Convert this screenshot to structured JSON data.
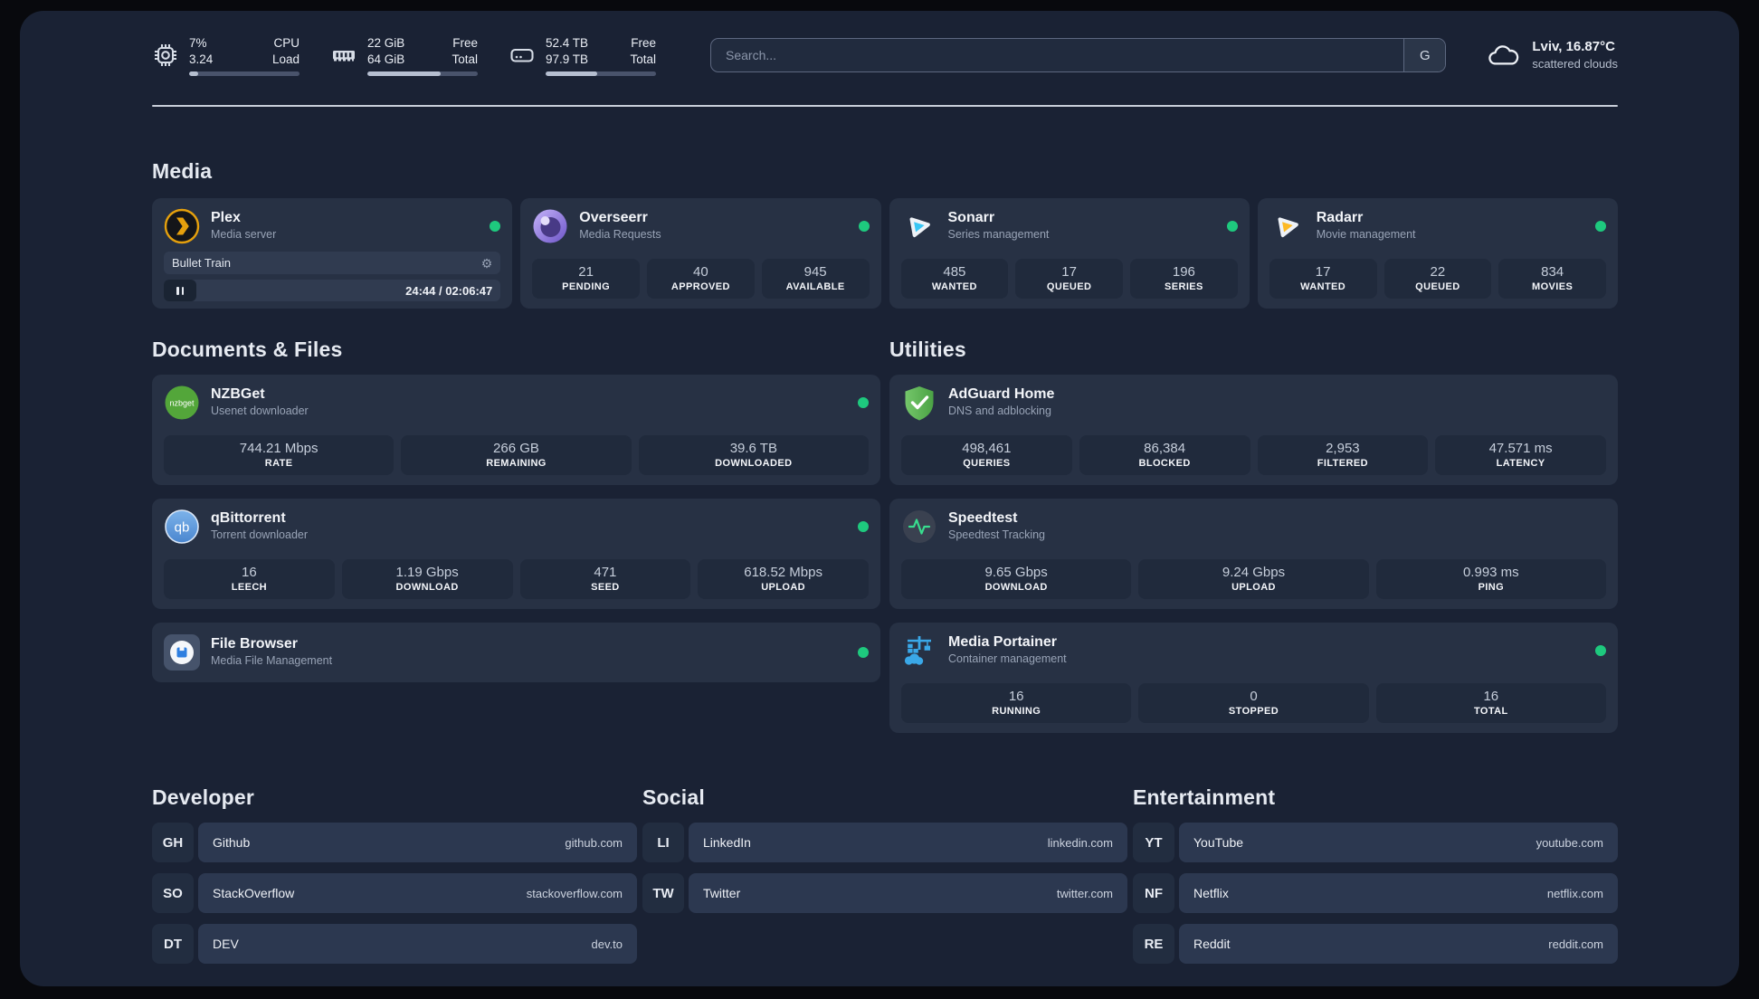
{
  "colors": {
    "status_online": "#1ec97e",
    "plex_accent": "#e5a00d",
    "sonarr_accent": "#38c6f4",
    "radarr_accent": "#fdb924",
    "adguard_green": "#57b14e",
    "portainer_blue": "#3aa8e8",
    "nzbget_green": "#53a63a",
    "speedtest_pulse": "#38dd8e"
  },
  "icons": {
    "gear": "⚙"
  },
  "header": {
    "system_widgets": [
      {
        "icon": "cpu-icon",
        "values": [
          "7%",
          "3.24"
        ],
        "labels": [
          "CPU",
          "Load"
        ],
        "progress_percent": 8
      },
      {
        "icon": "ram-icon",
        "values": [
          "22 GiB",
          "64 GiB"
        ],
        "labels": [
          "Free",
          "Total"
        ],
        "progress_percent": 66
      },
      {
        "icon": "disk-icon",
        "values": [
          "52.4 TB",
          "97.9 TB"
        ],
        "labels": [
          "Free",
          "Total"
        ],
        "progress_percent": 47
      }
    ],
    "search": {
      "placeholder": "Search...",
      "engine_button": "G"
    },
    "weather": {
      "icon": "cloud-icon",
      "title": "Lviv, 16.87°C",
      "subtitle": "scattered clouds"
    }
  },
  "sections": {
    "media": {
      "heading": "Media",
      "cards": {
        "plex": {
          "icon": "plex-icon",
          "title": "Plex",
          "subtitle": "Media server",
          "online": true,
          "player": {
            "now_playing": "Bullet Train",
            "time": "24:44 / 02:06:47"
          }
        },
        "overseerr": {
          "icon": "overseerr-icon",
          "title": "Overseerr",
          "subtitle": "Media Requests",
          "online": true,
          "stats": [
            {
              "value": "21",
              "label": "PENDING"
            },
            {
              "value": "40",
              "label": "APPROVED"
            },
            {
              "value": "945",
              "label": "AVAILABLE"
            }
          ]
        },
        "sonarr": {
          "icon": "sonarr-icon",
          "title": "Sonarr",
          "subtitle": "Series management",
          "online": true,
          "stats": [
            {
              "value": "485",
              "label": "WANTED"
            },
            {
              "value": "17",
              "label": "QUEUED"
            },
            {
              "value": "196",
              "label": "SERIES"
            }
          ]
        },
        "radarr": {
          "icon": "radarr-icon",
          "title": "Radarr",
          "subtitle": "Movie management",
          "online": true,
          "stats": [
            {
              "value": "17",
              "label": "WANTED"
            },
            {
              "value": "22",
              "label": "QUEUED"
            },
            {
              "value": "834",
              "label": "MOVIES"
            }
          ]
        }
      }
    },
    "documents": {
      "heading": "Documents & Files",
      "cards": {
        "nzbget": {
          "icon": "nzbget-icon",
          "title": "NZBGet",
          "subtitle": "Usenet downloader",
          "online": true,
          "stats": [
            {
              "value": "744.21 Mbps",
              "label": "RATE"
            },
            {
              "value": "266 GB",
              "label": "REMAINING"
            },
            {
              "value": "39.6 TB",
              "label": "DOWNLOADED"
            }
          ]
        },
        "qbittorrent": {
          "icon": "qbittorrent-icon",
          "title": "qBittorrent",
          "subtitle": "Torrent downloader",
          "online": true,
          "stats": [
            {
              "value": "16",
              "label": "LEECH"
            },
            {
              "value": "1.19 Gbps",
              "label": "DOWNLOAD"
            },
            {
              "value": "471",
              "label": "SEED"
            },
            {
              "value": "618.52 Mbps",
              "label": "UPLOAD"
            }
          ]
        },
        "filebrowser": {
          "icon": "filebrowser-icon",
          "title": "File Browser",
          "subtitle": "Media File Management",
          "online": true
        }
      }
    },
    "utilities": {
      "heading": "Utilities",
      "cards": {
        "adguard": {
          "icon": "adguard-icon",
          "title": "AdGuard Home",
          "subtitle": "DNS and adblocking",
          "stats": [
            {
              "value": "498,461",
              "label": "QUERIES"
            },
            {
              "value": "86,384",
              "label": "BLOCKED"
            },
            {
              "value": "2,953",
              "label": "FILTERED"
            },
            {
              "value": "47.571 ms",
              "label": "LATENCY"
            }
          ]
        },
        "speedtest": {
          "icon": "speedtest-icon",
          "title": "Speedtest",
          "subtitle": "Speedtest Tracking",
          "stats": [
            {
              "value": "9.65 Gbps",
              "label": "DOWNLOAD"
            },
            {
              "value": "9.24 Gbps",
              "label": "UPLOAD"
            },
            {
              "value": "0.993 ms",
              "label": "PING"
            }
          ]
        },
        "portainer": {
          "icon": "portainer-icon",
          "title": "Media Portainer",
          "subtitle": "Container management",
          "online": true,
          "stats": [
            {
              "value": "16",
              "label": "RUNNING"
            },
            {
              "value": "0",
              "label": "STOPPED"
            },
            {
              "value": "16",
              "label": "TOTAL"
            }
          ]
        }
      }
    },
    "links": {
      "developer": {
        "heading": "Developer",
        "items": [
          {
            "abbr": "GH",
            "name": "Github",
            "url": "github.com"
          },
          {
            "abbr": "SO",
            "name": "StackOverflow",
            "url": "stackoverflow.com"
          },
          {
            "abbr": "DT",
            "name": "DEV",
            "url": "dev.to"
          }
        ]
      },
      "social": {
        "heading": "Social",
        "items": [
          {
            "abbr": "LI",
            "name": "LinkedIn",
            "url": "linkedin.com"
          },
          {
            "abbr": "TW",
            "name": "Twitter",
            "url": "twitter.com"
          }
        ]
      },
      "entertainment": {
        "heading": "Entertainment",
        "items": [
          {
            "abbr": "YT",
            "name": "YouTube",
            "url": "youtube.com"
          },
          {
            "abbr": "NF",
            "name": "Netflix",
            "url": "netflix.com"
          },
          {
            "abbr": "RE",
            "name": "Reddit",
            "url": "reddit.com"
          }
        ]
      }
    }
  }
}
